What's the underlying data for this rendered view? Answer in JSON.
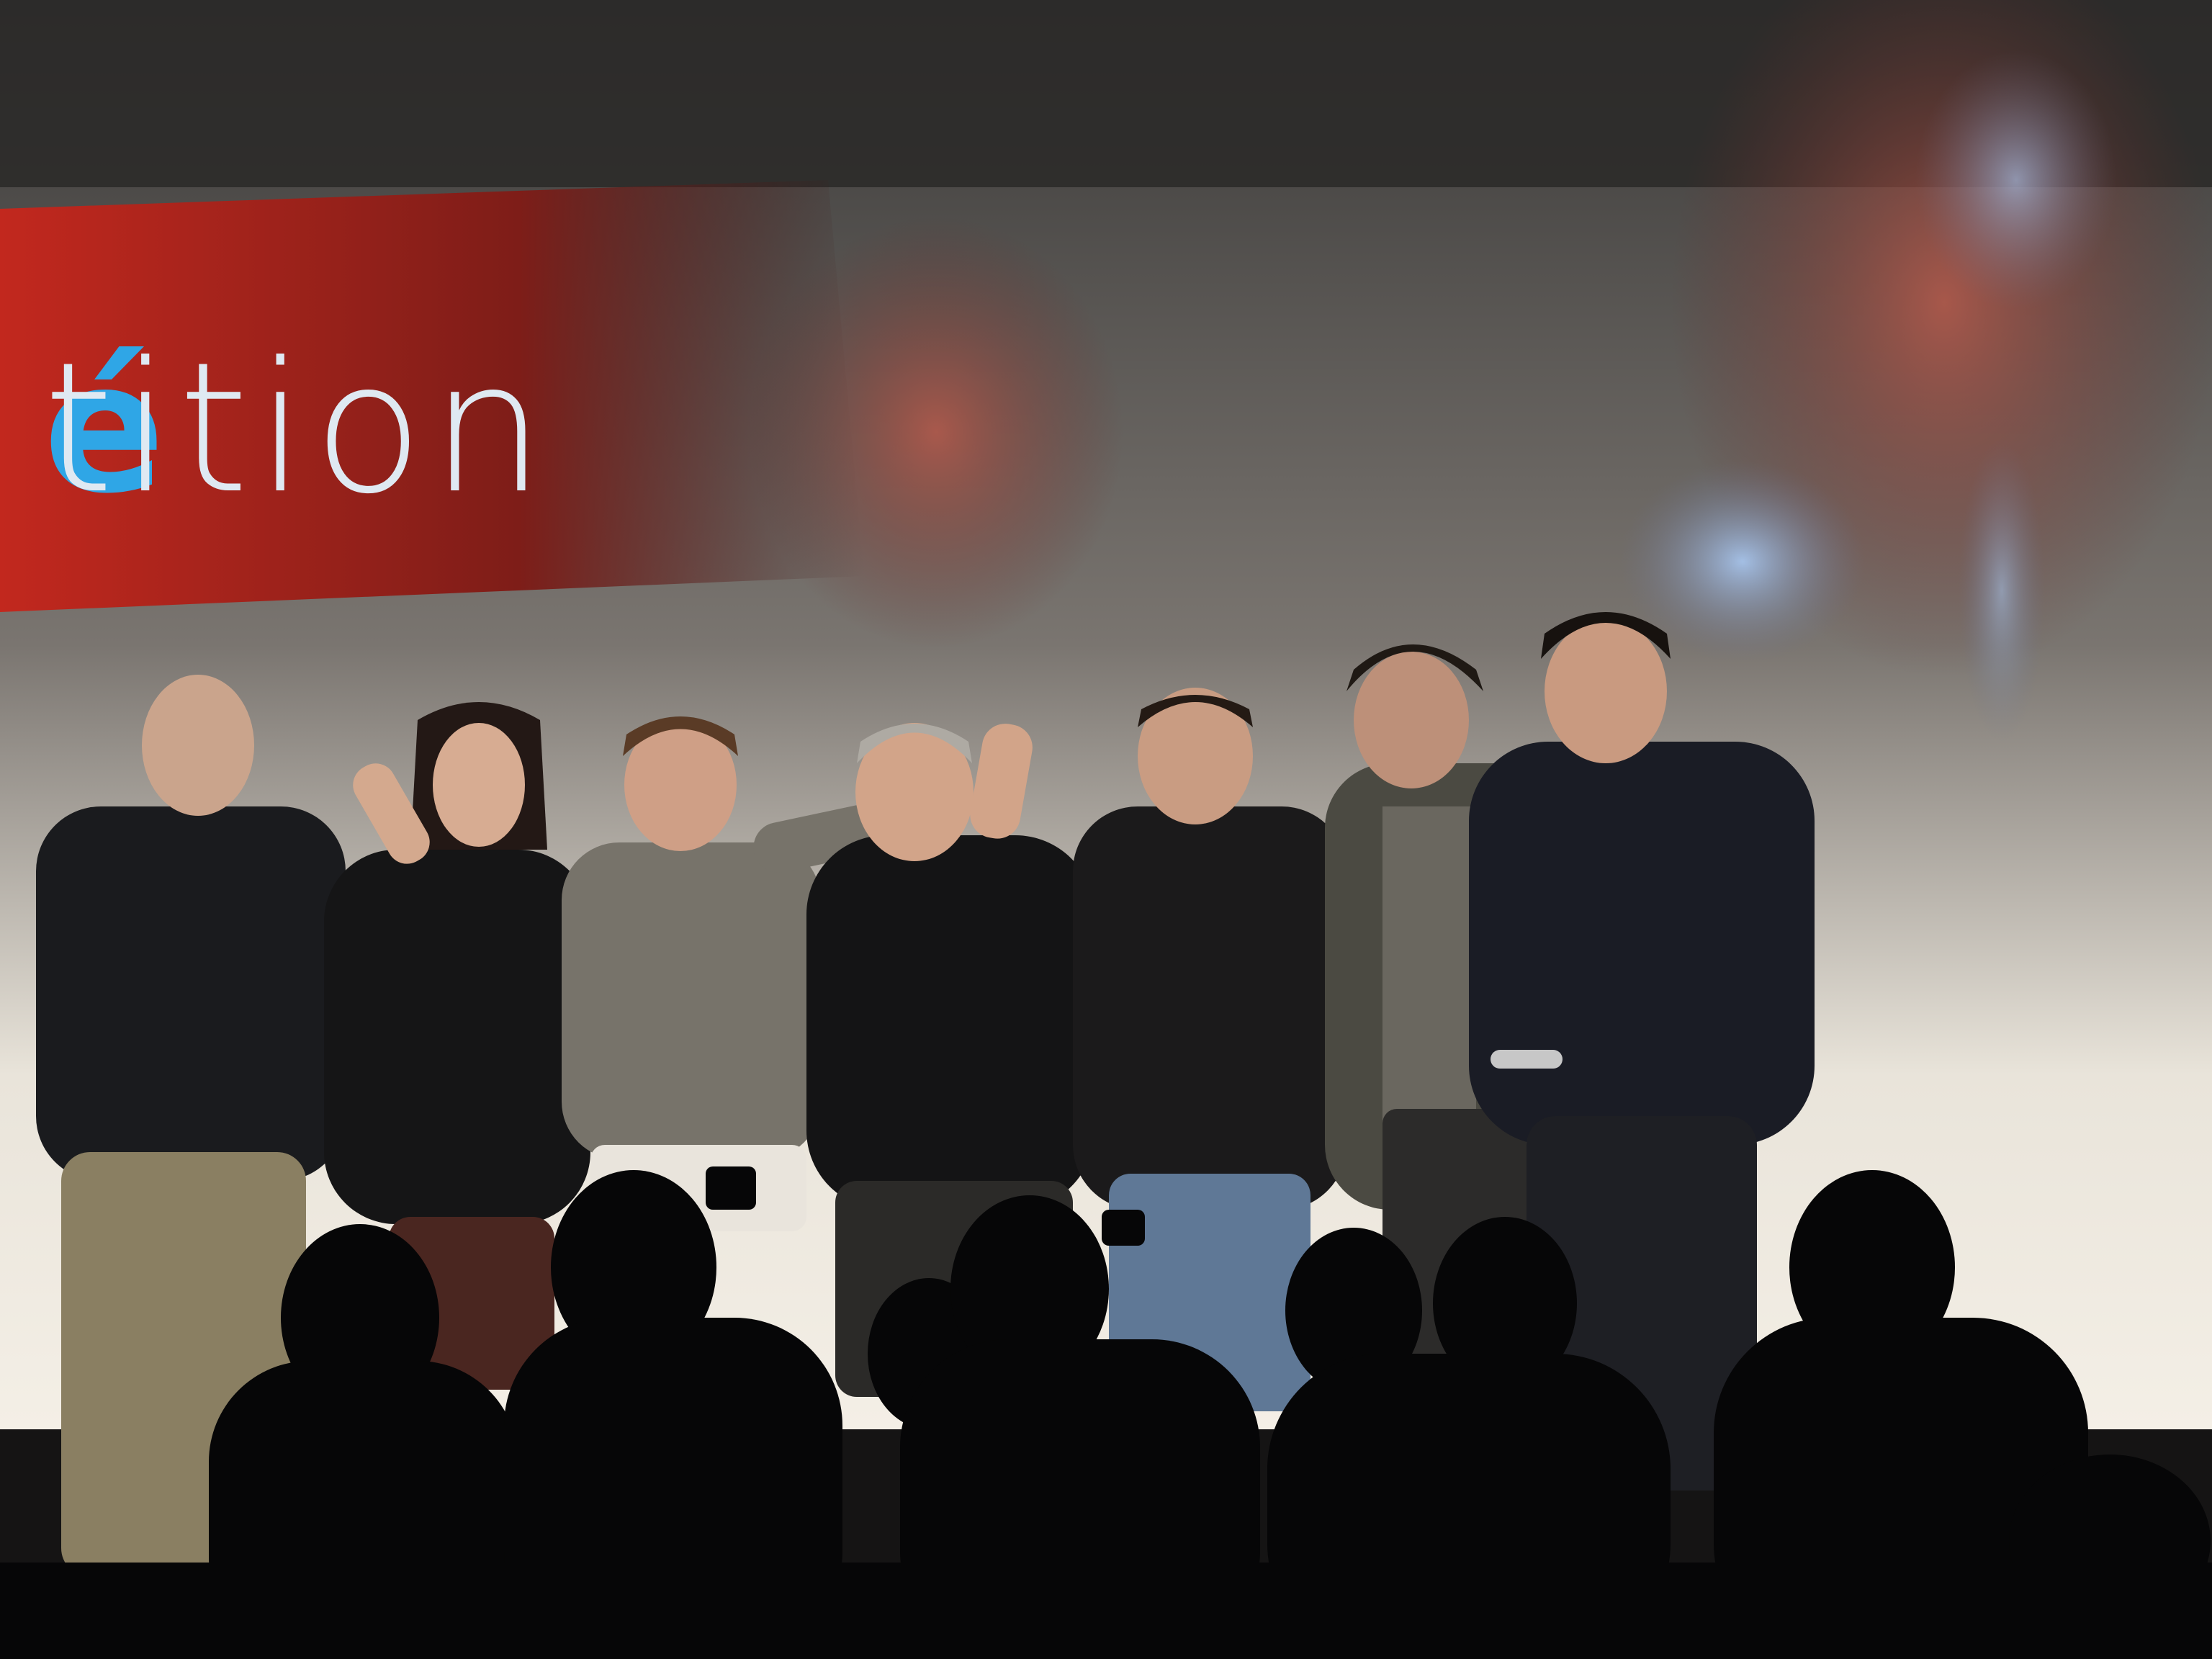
{
  "scene": {
    "screen_text": {
      "accent_letter": "é",
      "rest": "tition"
    },
    "colors": {
      "stage_dark": "#0b0b0d",
      "screen_gray": "#d9d6d0",
      "banner_red": "#a8231c",
      "text_blue": "#2fa6e6",
      "text_light": "#dfe9f2"
    },
    "people_on_stage": 7,
    "description_free": true
  }
}
